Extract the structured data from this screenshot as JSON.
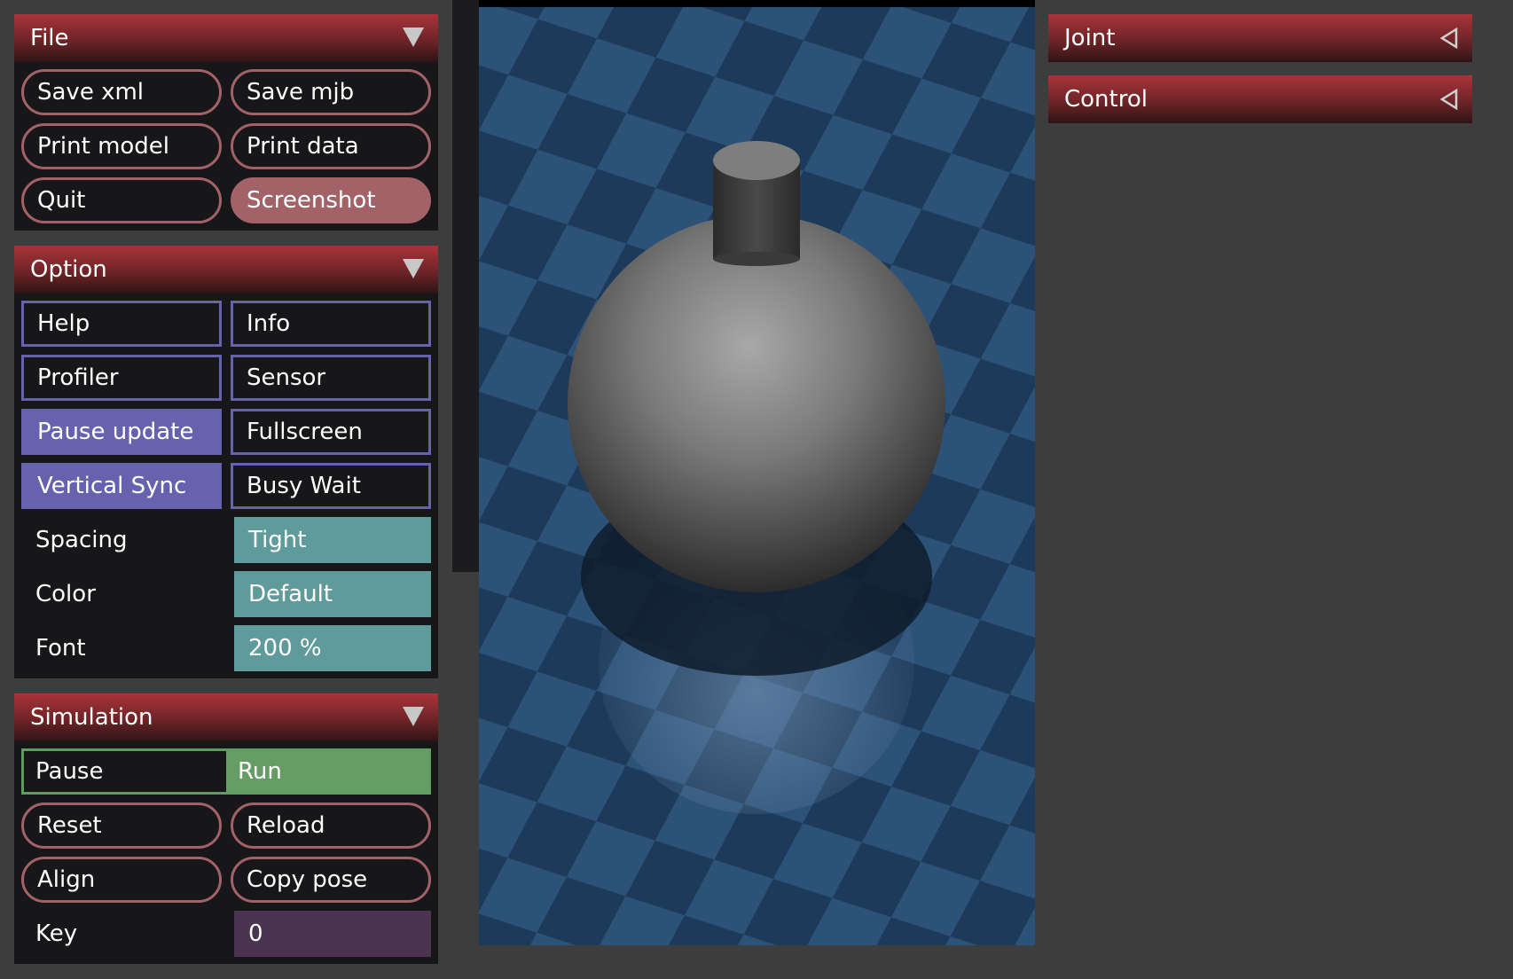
{
  "file": {
    "title": "File",
    "buttons": [
      "Save xml",
      "Save mjb",
      "Print model",
      "Print data",
      "Quit",
      "Screenshot"
    ]
  },
  "option": {
    "title": "Option",
    "checks": [
      {
        "label": "Help",
        "checked": false
      },
      {
        "label": "Info",
        "checked": false
      },
      {
        "label": "Profiler",
        "checked": false
      },
      {
        "label": "Sensor",
        "checked": false
      },
      {
        "label": "Pause update",
        "checked": true
      },
      {
        "label": "Fullscreen",
        "checked": false
      },
      {
        "label": "Vertical Sync",
        "checked": true
      },
      {
        "label": "Busy Wait",
        "checked": false
      }
    ],
    "spacing_label": "Spacing",
    "spacing_value": "Tight",
    "color_label": "Color",
    "color_value": "Default",
    "font_label": "Font",
    "font_value": "200 %"
  },
  "simulation": {
    "title": "Simulation",
    "radio": [
      "Pause",
      "Run"
    ],
    "radio_selected": "Run",
    "buttons": [
      "Reset",
      "Reload",
      "Align",
      "Copy pose"
    ],
    "key_label": "Key",
    "key_value": "0"
  },
  "right": {
    "sections": [
      "Joint",
      "Control"
    ]
  },
  "colors": {
    "header_red": "#a8343a",
    "button_border": "#a26268",
    "check_purple": "#6662ad",
    "select_teal": "#5f9b9b",
    "radio_green": "#659d65",
    "edit_purple": "#4a3450",
    "panel_bg": "#171719",
    "window_bg": "#3d3d3d"
  },
  "icons": {
    "expanded": "triangle-down-icon",
    "collapsed": "triangle-left-icon"
  }
}
